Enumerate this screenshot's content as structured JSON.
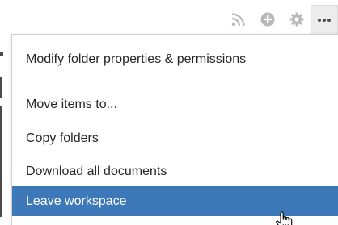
{
  "toolbar": {
    "icons": [
      "rss-icon",
      "add-circle-icon",
      "gear-icon",
      "more-options-icon"
    ]
  },
  "menu": {
    "items": [
      {
        "label": "Modify folder properties & permissions"
      },
      {
        "label": "Move items to..."
      },
      {
        "label": "Copy folders"
      },
      {
        "label": "Download all documents"
      },
      {
        "label": "Leave workspace",
        "highlighted": true
      }
    ]
  },
  "colors": {
    "highlight": "#3d78b8",
    "icon_gray": "#b8b8b8",
    "text": "#262626"
  }
}
